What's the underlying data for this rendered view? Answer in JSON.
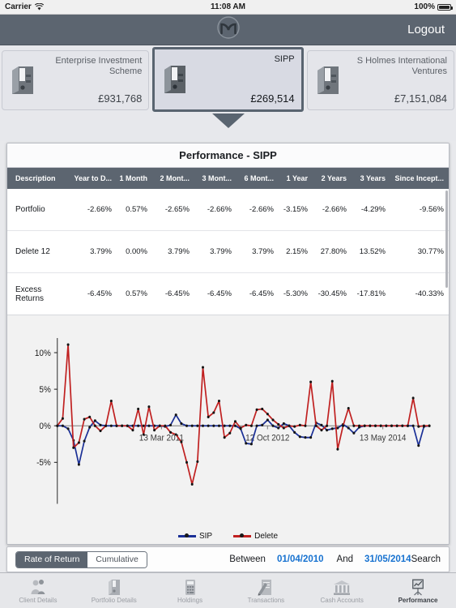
{
  "statusbar": {
    "carrier": "Carrier",
    "wifi_icon": "wifi-icon",
    "time": "11:08 AM",
    "battery_pct": "100%"
  },
  "navbar": {
    "logo_icon": "app-logo-icon",
    "logout_label": "Logout"
  },
  "portfolios": [
    {
      "name": "Enterprise Investment Scheme",
      "amount": "£931,768",
      "selected": false,
      "icon": "binder-icon"
    },
    {
      "name": "SIPP",
      "amount": "£269,514",
      "selected": true,
      "icon": "binder-icon"
    },
    {
      "name": "S Holmes International Ventures",
      "amount": "£7,151,084",
      "selected": false,
      "icon": "binder-icon"
    }
  ],
  "panel": {
    "title": "Performance - SIPP",
    "columns": [
      "Description",
      "Year to D...",
      "1 Month",
      "2 Mont...",
      "3 Mont...",
      "6 Mont...",
      "1 Year",
      "2 Years",
      "3 Years",
      "Since Incept..."
    ],
    "rows": [
      {
        "description": "Portfolio",
        "values": [
          "-2.66%",
          "0.57%",
          "-2.65%",
          "-2.66%",
          "-2.66%",
          "-3.15%",
          "-2.66%",
          "-4.29%",
          "-9.56%"
        ]
      },
      {
        "description": "Delete 12",
        "values": [
          "3.79%",
          "0.00%",
          "3.79%",
          "3.79%",
          "3.79%",
          "2.15%",
          "27.80%",
          "13.52%",
          "30.77%"
        ]
      },
      {
        "description": "Excess Returns",
        "values": [
          "-6.45%",
          "0.57%",
          "-6.45%",
          "-6.45%",
          "-6.45%",
          "-5.30%",
          "-30.45%",
          "-17.81%",
          "-40.33%"
        ]
      }
    ]
  },
  "filterbar": {
    "segments": [
      {
        "label": "Rate of Return",
        "active": true
      },
      {
        "label": "Cumulative",
        "active": false
      }
    ],
    "between_label": "Between",
    "start_date": "01/04/2010",
    "and_label": "And",
    "end_date": "31/05/2014",
    "search_label": "Search"
  },
  "tabs": [
    {
      "label": "Client Details",
      "icon": "people-icon",
      "active": false
    },
    {
      "label": "Portfolio Details",
      "icon": "binder-icon",
      "active": false
    },
    {
      "label": "Holdings",
      "icon": "calculator-icon",
      "active": false
    },
    {
      "label": "Transactions",
      "icon": "document-pen-icon",
      "active": false
    },
    {
      "label": "Cash Accounts",
      "icon": "bank-icon",
      "active": false
    },
    {
      "label": "Performance",
      "icon": "chart-easel-icon",
      "active": true
    }
  ],
  "chart_data": {
    "type": "line",
    "title": "",
    "xlabel": "",
    "ylabel": "",
    "ylim": [
      -9,
      12
    ],
    "yticks": [
      10,
      5,
      0,
      -5
    ],
    "ytick_labels": [
      "10%",
      "5%",
      "0%",
      "-5%"
    ],
    "xtick_labels": [
      "13 Mar 2011",
      "12 Oct 2012",
      "13 May 2014"
    ],
    "grid": false,
    "legend_position": "bottom",
    "colors": {
      "SIP": "#1a2f96",
      "Delete": "#c02020"
    },
    "series": [
      {
        "name": "SIP",
        "color": "#1a2f96",
        "values": [
          0.0,
          0.0,
          -0.4,
          -2.0,
          -5.3,
          -2.1,
          -0.2,
          0.7,
          0.1,
          0.0,
          0.0,
          0.0,
          0.0,
          0.0,
          0.0,
          0.0,
          0.0,
          0.0,
          0.0,
          0.0,
          -0.1,
          0.1,
          1.5,
          0.3,
          0.0,
          0.0,
          0.0,
          0.0,
          0.0,
          0.0,
          0.0,
          0.0,
          0.0,
          0.0,
          -0.4,
          -2.4,
          -2.5,
          0.0,
          0.1,
          0.8,
          0.0,
          -0.3,
          0.3,
          0.0,
          -0.9,
          -1.5,
          -1.6,
          -1.6,
          0.4,
          0.1,
          -0.6,
          -0.4,
          -0.3,
          0.2,
          -0.3,
          -1.0,
          -0.2,
          0.0,
          0.0,
          0.0,
          0.0,
          0.0,
          0.0,
          0.0,
          0.0,
          0.0,
          0.0,
          -2.7,
          -0.1,
          0.0
        ]
      },
      {
        "name": "Delete",
        "color": "#c02020",
        "values": [
          0.0,
          1.0,
          11.1,
          -3.0,
          -2.3,
          0.9,
          1.2,
          0.0,
          -0.7,
          0.0,
          3.4,
          0.0,
          0.0,
          0.0,
          -0.6,
          2.3,
          -1.2,
          2.6,
          -0.6,
          0.0,
          0.0,
          -0.9,
          -1.2,
          -2.2,
          -5.0,
          -8.0,
          -4.9,
          8.0,
          1.2,
          1.8,
          3.4,
          -1.6,
          -1.0,
          0.6,
          -0.3,
          0.1,
          0.0,
          2.2,
          2.3,
          1.6,
          0.8,
          0.2,
          -0.3,
          0.0,
          -0.1,
          0.1,
          0.0,
          6.0,
          0.0,
          -0.6,
          0.0,
          6.1,
          -3.2,
          0.0,
          2.4,
          0.0,
          0.0,
          0.0,
          0.0,
          0.0,
          0.0,
          0.0,
          0.0,
          0.0,
          0.0,
          0.0,
          3.8,
          -0.1,
          0.0,
          0.0
        ]
      }
    ]
  }
}
